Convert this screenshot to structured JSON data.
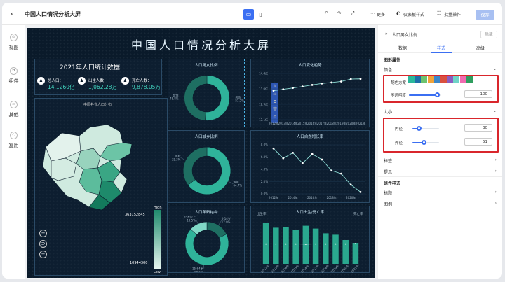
{
  "app": {
    "title": "中国人口情况分析大屏"
  },
  "toolbar": {
    "back": "‹",
    "more": "更多",
    "theme": "仪表板样式",
    "batch": "批量操作",
    "save": "保存"
  },
  "sidebar": {
    "items": [
      {
        "label": "视图",
        "icon": "view-icon"
      },
      {
        "label": "组件",
        "icon": "component-icon"
      },
      {
        "label": "其他",
        "icon": "other-icon"
      },
      {
        "label": "复用",
        "icon": "reuse-icon"
      }
    ]
  },
  "dashboard": {
    "title": "中国人口情况分析大屏",
    "stats_title": "2021年人口统计数据",
    "stats": [
      {
        "label": "总人口：",
        "value": "14.1260亿"
      },
      {
        "label": "出生人数：",
        "value": "1,062.28万"
      },
      {
        "label": "死亡人数：",
        "value": "9,878.05万"
      }
    ],
    "map_title": "中国各省人口分布",
    "map_legend": {
      "high": "High",
      "low": "Low",
      "max": "363152845",
      "min": "10944300"
    },
    "panels": {
      "gender": "人口男女比例",
      "trend": "人口变化趋势",
      "urban": "人口城乡比例",
      "growth": "人口自然增长率",
      "age": "人口年龄结构",
      "birth": "人口出生/死亡率"
    },
    "birth_legend": {
      "left": "出生率",
      "right": "死亡率"
    }
  },
  "chart_data": [
    {
      "type": "pie",
      "title": "人口男女比例",
      "categories": [
        "男性",
        "女性"
      ],
      "values": [
        51.2,
        48.8
      ]
    },
    {
      "type": "line",
      "title": "人口变化趋势",
      "ylim": [
        12.1,
        14.4
      ],
      "yticks": [
        "14.4亿",
        "13.6亿",
        "12.9亿",
        "12.1亿"
      ],
      "categories": [
        "2012年",
        "2013年",
        "2014年",
        "2015年",
        "2016年",
        "2017年",
        "2018年",
        "2019年",
        "2020年",
        "2021年"
      ],
      "values": [
        13.54,
        13.61,
        13.68,
        13.75,
        13.83,
        13.9,
        13.95,
        14.0,
        14.12,
        14.13
      ]
    },
    {
      "type": "pie",
      "title": "人口城乡比例",
      "categories": [
        "城镇",
        "乡村"
      ],
      "values": [
        64.7,
        35.3
      ]
    },
    {
      "type": "line",
      "title": "人口自然增长率",
      "ylim": [
        0,
        8
      ],
      "yticks": [
        "8.0%",
        "6.0%",
        "4.0%",
        "2.0%",
        "0.0%"
      ],
      "categories": [
        "2012年",
        "2013年",
        "2014年",
        "2015年",
        "2016年",
        "2017年",
        "2018年",
        "2019年",
        "2020年",
        "2021年"
      ],
      "xticks_shown": [
        "2012年",
        "2014年",
        "2016年",
        "2018年",
        "2020年"
      ],
      "values": [
        7.4,
        5.8,
        6.7,
        5.0,
        6.5,
        5.6,
        3.8,
        3.3,
        1.5,
        0.3
      ]
    },
    {
      "type": "pie",
      "title": "人口年龄结构",
      "categories": [
        "0-14岁",
        "15-64岁",
        "65岁以上"
      ],
      "values": [
        17.9,
        68.6,
        13.5
      ]
    },
    {
      "type": "bar",
      "title": "人口出生/死亡率",
      "categories": [
        "2012年",
        "2013年",
        "2014年",
        "2015年",
        "2016年",
        "2017年",
        "2018年",
        "2019年",
        "2020年",
        "2021年"
      ],
      "series": [
        {
          "name": "出生率",
          "values": [
            14.6,
            12.9,
            13.1,
            12.1,
            13.6,
            12.6,
            10.9,
            10.4,
            8.5,
            7.5
          ]
        },
        {
          "name": "死亡率",
          "values": [
            7.1,
            7.1,
            7.1,
            7.1,
            7.0,
            7.1,
            7.1,
            7.1,
            7.1,
            7.2
          ]
        }
      ]
    }
  ],
  "right_panel": {
    "component": "人口男女比例",
    "close": "隐藏",
    "tabs": [
      "数据",
      "样式",
      "高级"
    ],
    "active_tab": "样式",
    "sections": {
      "shape": "图形属性",
      "color": "颜色",
      "palette": "配色方案",
      "opacity": "不透明度",
      "opacity_value": "100",
      "size": "大小",
      "inner": "内径",
      "inner_value": "30",
      "outer": "外径",
      "outer_value": "51",
      "label": "标签",
      "tooltip": "提示",
      "comp_style": "组件样式",
      "heading": "标题",
      "legend": "图例"
    },
    "palette": [
      "#2bb89b",
      "#1e6fa8",
      "#6cc36e",
      "#f1a33a",
      "#3b87c9",
      "#d9503f",
      "#8a5cc1",
      "#6fd3c7",
      "#f06ab0",
      "#2f9e5f"
    ],
    "accent": "#3b6ff2",
    "highlight": "#d9262c"
  }
}
